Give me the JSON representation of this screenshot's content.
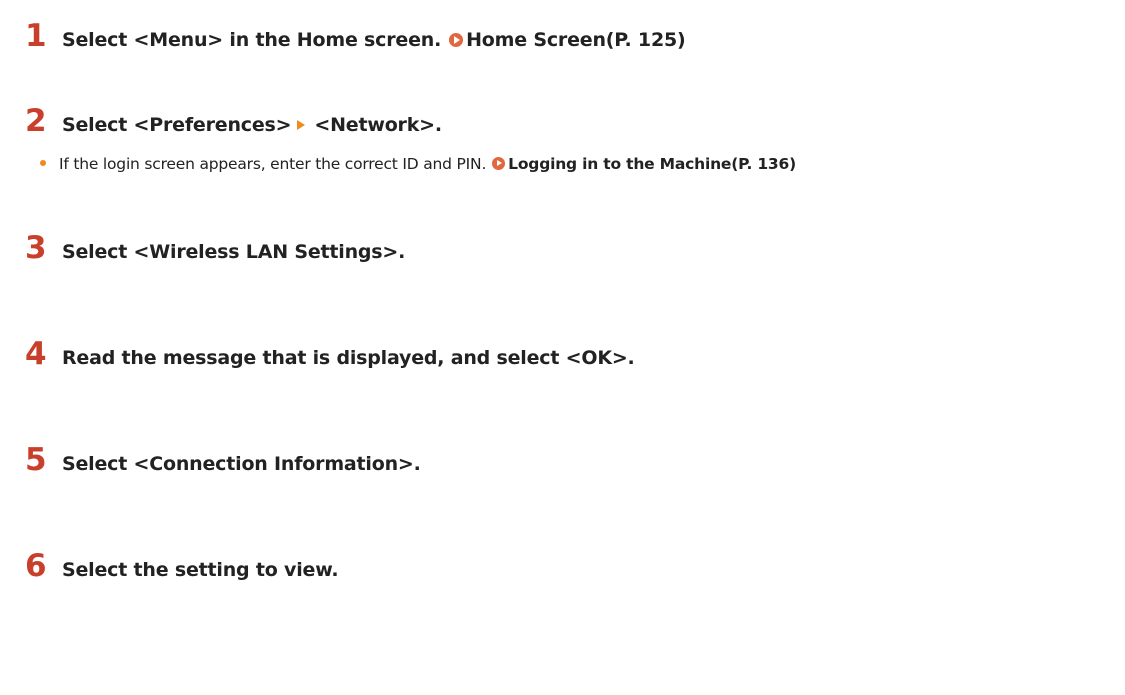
{
  "steps": [
    {
      "number": "1",
      "text": "Select <Menu> in the Home screen.",
      "link": "Home Screen(P. 125)"
    },
    {
      "number": "2",
      "text_before": "Select <Preferences>",
      "text_after": "<Network>."
    },
    {
      "number": "3",
      "text": "Select <Wireless LAN Settings>."
    },
    {
      "number": "4",
      "text": "Read the message that is displayed, and select <OK>."
    },
    {
      "number": "5",
      "text": "Select <Connection Information>."
    },
    {
      "number": "6",
      "text": "Select the setting to view."
    }
  ],
  "note": {
    "text": "If the login screen appears, enter the correct ID and PIN.",
    "link": "Logging in to the Machine(P. 136)"
  },
  "colors": {
    "step_number": "#c8402c",
    "link_icon": "#e2673e",
    "arrow": "#ef8a1c",
    "bullet": "#ef8a1c"
  }
}
